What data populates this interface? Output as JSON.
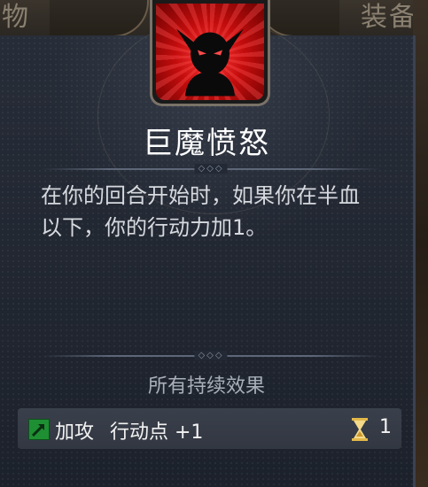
{
  "tabs": {
    "left_label": "物",
    "right_label": "装备"
  },
  "ability": {
    "title": "巨魔愤怒",
    "description": "在你的回合开始时，如果你在半血以下，你的行动力加1。",
    "icon": "demon-head-icon"
  },
  "effects_section": {
    "label": "所有持续效果",
    "items": [
      {
        "name": "加攻",
        "detail": "行动点 +1",
        "icon": "green-arrow-icon",
        "duration_icon": "hourglass-icon",
        "duration": "1"
      }
    ]
  },
  "colors": {
    "icon_red": "#c40d0d",
    "effect_green": "#1e8f33",
    "hourglass_gold": "#e2b84a"
  }
}
